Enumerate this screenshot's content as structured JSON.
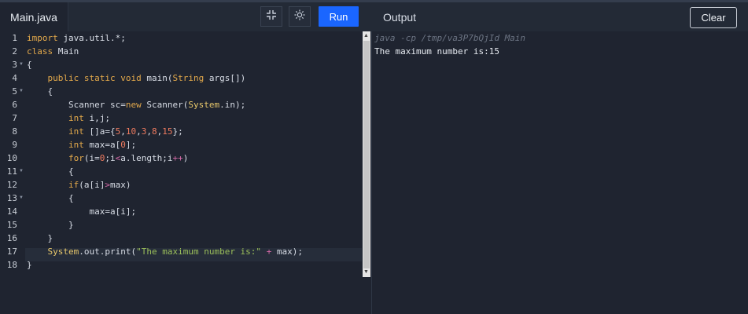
{
  "header": {
    "file_tab": "Main.java",
    "run_label": "Run",
    "output_title": "Output",
    "clear_label": "Clear"
  },
  "editor": {
    "line_numbers": [
      "1",
      "2",
      "3",
      "4",
      "5",
      "6",
      "7",
      "8",
      "9",
      "10",
      "11",
      "12",
      "13",
      "14",
      "15",
      "16",
      "17",
      "18"
    ],
    "lines": [
      [
        [
          "kw",
          "import "
        ],
        [
          "pl",
          "java.util.*;"
        ]
      ],
      [
        [
          "kw",
          "class "
        ],
        [
          "pl",
          "Main"
        ]
      ],
      [
        [
          "pl",
          "{"
        ]
      ],
      [
        [
          "pl",
          "    "
        ],
        [
          "kw",
          "public static void "
        ],
        [
          "pl",
          "main("
        ],
        [
          "ty",
          "String"
        ],
        [
          "pl",
          " args[])"
        ]
      ],
      [
        [
          "pl",
          "    {"
        ]
      ],
      [
        [
          "pl",
          "        Scanner sc="
        ],
        [
          "kw",
          "new "
        ],
        [
          "pl",
          "Scanner("
        ],
        [
          "sys",
          "System"
        ],
        [
          "pl",
          ".in);"
        ]
      ],
      [
        [
          "pl",
          "        "
        ],
        [
          "kw",
          "int "
        ],
        [
          "pl",
          "i,j;"
        ]
      ],
      [
        [
          "pl",
          "        "
        ],
        [
          "kw",
          "int "
        ],
        [
          "pl",
          "[]a={"
        ],
        [
          "num",
          "5"
        ],
        [
          "pl",
          ","
        ],
        [
          "num",
          "10"
        ],
        [
          "pl",
          ","
        ],
        [
          "num",
          "3"
        ],
        [
          "pl",
          ","
        ],
        [
          "num",
          "8"
        ],
        [
          "pl",
          ","
        ],
        [
          "num",
          "15"
        ],
        [
          "pl",
          "};"
        ]
      ],
      [
        [
          "pl",
          "        "
        ],
        [
          "kw",
          "int "
        ],
        [
          "pl",
          "max=a["
        ],
        [
          "num",
          "0"
        ],
        [
          "pl",
          "];"
        ]
      ],
      [
        [
          "pl",
          "        "
        ],
        [
          "kw",
          "for"
        ],
        [
          "pl",
          "(i="
        ],
        [
          "num",
          "0"
        ],
        [
          "pl",
          ";i"
        ],
        [
          "op",
          "<"
        ],
        [
          "pl",
          "a.length;i"
        ],
        [
          "op",
          "++"
        ],
        [
          "pl",
          ")"
        ]
      ],
      [
        [
          "pl",
          "        {"
        ]
      ],
      [
        [
          "pl",
          "        "
        ],
        [
          "kw",
          "if"
        ],
        [
          "pl",
          "(a[i]"
        ],
        [
          "op",
          ">"
        ],
        [
          "pl",
          "max)"
        ]
      ],
      [
        [
          "pl",
          "        {"
        ]
      ],
      [
        [
          "pl",
          "            max=a[i];"
        ]
      ],
      [
        [
          "pl",
          "        }"
        ]
      ],
      [
        [
          "pl",
          "    }"
        ]
      ],
      [
        [
          "pl",
          "    "
        ],
        [
          "sys",
          "System"
        ],
        [
          "pl",
          ".out.print("
        ],
        [
          "str",
          "\"The maximum number is:\""
        ],
        [
          "pl",
          " "
        ],
        [
          "op",
          "+"
        ],
        [
          "pl",
          " max);"
        ]
      ],
      [
        [
          "pl",
          "}"
        ]
      ]
    ]
  },
  "output": {
    "command": "java -cp /tmp/va3P7bQjId Main",
    "result": "The maximum number is:15"
  }
}
